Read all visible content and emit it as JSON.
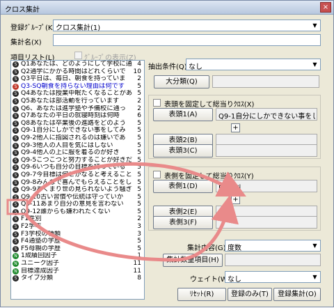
{
  "window": {
    "title": "クロス集計",
    "close": "×"
  },
  "form": {
    "group_label": "登録ｸﾞﾙｰﾌﾟ(K)",
    "group_value": "クロス集計(1)",
    "name_label": "集計名(X)",
    "name_value": ""
  },
  "items": {
    "label": "項目リスト(L)",
    "group_display_label": "ｸﾞﾙｰﾌﾟの表示(Z)",
    "rows": [
      {
        "icon": "S",
        "text": "Q1あなたは、どのようにして学校に通",
        "count": "4"
      },
      {
        "icon": "S",
        "text": "Q2通学にかかる時間はどれくらいで",
        "count": "10"
      },
      {
        "icon": "S",
        "text": "Q3平日は、毎日、朝食を持っていま",
        "count": "2"
      },
      {
        "icon": "S",
        "text": "Q3-SQ朝食を持らない理由は何です",
        "count": "5"
      },
      {
        "icon": "S",
        "text": "Q4あなたは授業中眠たくなることがあ",
        "count": "5"
      },
      {
        "icon": "S",
        "text": "Q5あなたは部活動を行っています",
        "count": "2"
      },
      {
        "icon": "S",
        "text": "Q6、あなたは進学塾や予備校に通っ",
        "count": "2"
      },
      {
        "icon": "S",
        "text": "Q7あなたの平日の就寝時刻は何時",
        "count": "6"
      },
      {
        "icon": "S",
        "text": "Q8あなたは卒業後の進路をどのよう",
        "count": "5"
      },
      {
        "icon": "S",
        "text": "Q9-1自分にしかできない事をしてみ",
        "count": "5"
      },
      {
        "icon": "S",
        "text": "Q9-2他人に指図されるのは嫌いであ",
        "count": "5"
      },
      {
        "icon": "S",
        "text": "Q9-3他人の人目を気にはしない",
        "count": "5"
      },
      {
        "icon": "S",
        "text": "Q9-4他人の上に服を着るのが好き",
        "count": "5"
      },
      {
        "icon": "S",
        "text": "Q9-5こつこつと努力することが好きだ",
        "count": "5"
      },
      {
        "icon": "S",
        "text": "Q9-6いつも自分の目標を持っている",
        "count": "5"
      },
      {
        "icon": "S",
        "text": "Q9-7今目標は何とかなると考えること",
        "count": "5"
      },
      {
        "icon": "S",
        "text": "Q9-8みんなで喜んでもらえることをし",
        "count": "5"
      },
      {
        "icon": "S",
        "text": "Q9-9あくまり世の見られないよう騒ぎ",
        "count": "5"
      },
      {
        "icon": "S",
        "text": "Q9-10古い習慣や伝統は守っていか",
        "count": "5"
      },
      {
        "icon": "S",
        "text": "Q9-11あまり自分の意見を言わない",
        "count": "5"
      },
      {
        "icon": "S",
        "text": "Q9-12誰からも嫌われたくない",
        "count": "5"
      },
      {
        "icon": "S",
        "text": "F1性別",
        "count": "2"
      },
      {
        "icon": "S",
        "text": "F2学年",
        "count": "3"
      },
      {
        "icon": "S",
        "text": "F3学校の種類",
        "count": "3"
      },
      {
        "icon": "S",
        "text": "F4通塾の学歴",
        "count": "5"
      },
      {
        "icon": "S",
        "text": "F5母親の学歴",
        "count": "5"
      },
      {
        "icon": "N",
        "text": "1成績回因子",
        "count": "1"
      },
      {
        "icon": "N",
        "text": "ユニーク因子",
        "count": "11"
      },
      {
        "icon": "N",
        "text": "目標達成因子",
        "count": "11"
      },
      {
        "icon": "S",
        "text": "タイプ分類",
        "count": "8"
      }
    ]
  },
  "right": {
    "extract_label": "抽出条件(Q)",
    "extract_value": "なし",
    "major_btn": "大分類(Q)",
    "head_group_check": "表頭を固定して総当りｸﾛｽ(X)",
    "head1_btn": "表頭1(A)",
    "head1_value": "Q9-1自分にしかできない事をしてみ",
    "head2_btn": "表頭2(B)",
    "head3_btn": "表頭3(C)",
    "side_group_check": "表側を固定して総当りｸﾛｽ(Y)",
    "side1_btn": "表側1(D)",
    "side1_value": "F1性別",
    "side2_btn": "表側2(E)",
    "side3_btn": "表側3(F)",
    "plus": "+",
    "content_label": "集計内容(G)",
    "content_value": "度数",
    "qty_btn": "集計数量項目(H)",
    "weight_label": "ウェイト(W)",
    "weight_value": "なし"
  },
  "buttons": {
    "reset": "ﾘｾｯﾄ(R)",
    "register_only": "登録のみ(T)",
    "register_total": "登録集計(O)"
  },
  "colors": {
    "arrow": "#e98a8a",
    "selected": "#0000cc"
  }
}
